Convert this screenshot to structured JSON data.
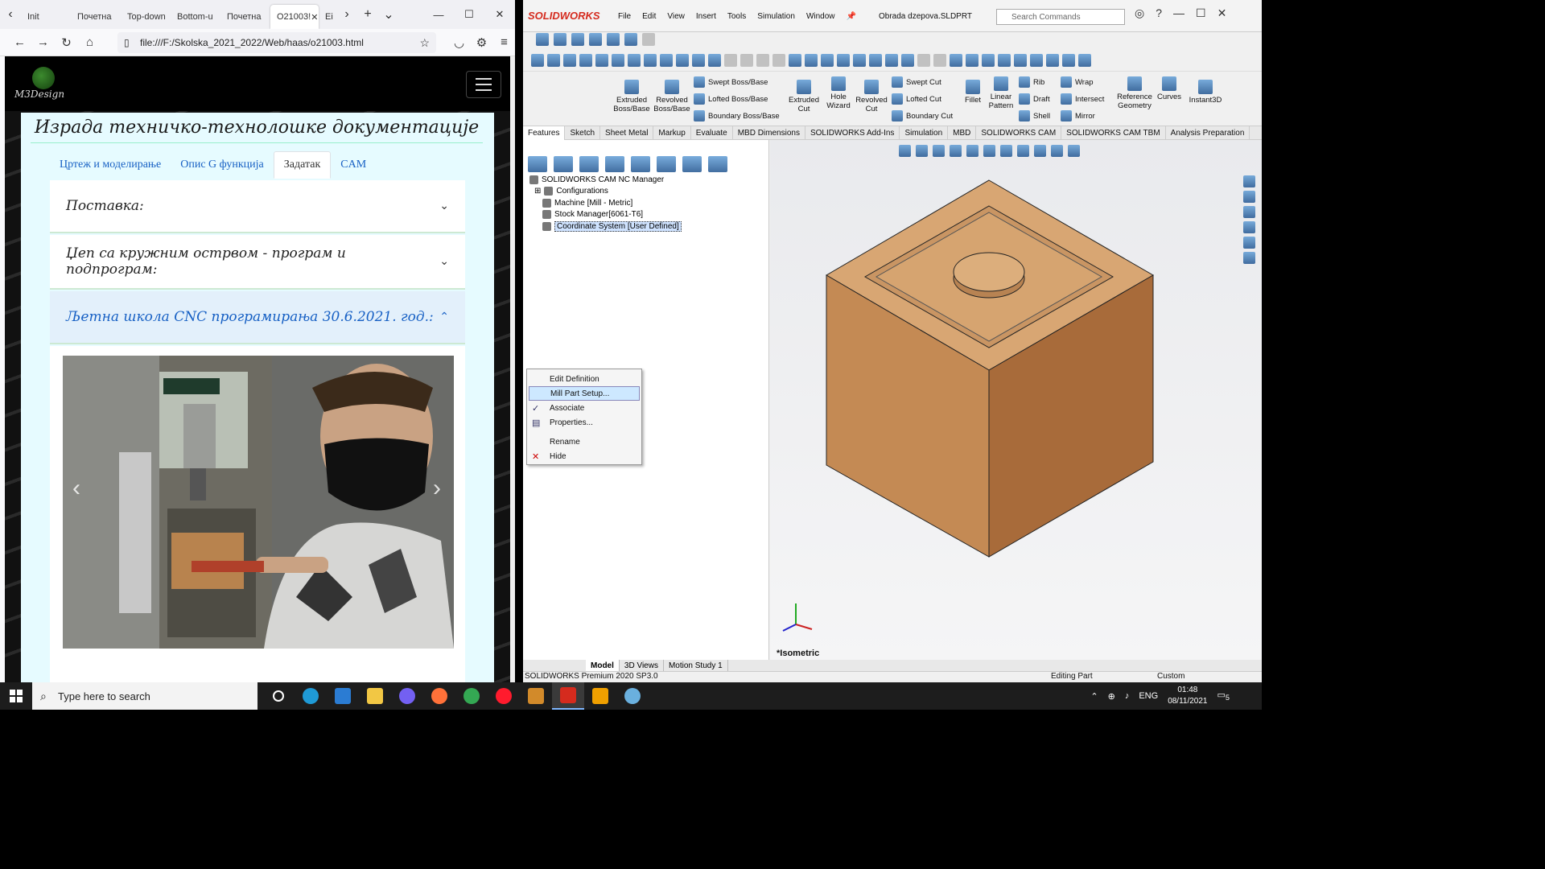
{
  "browser": {
    "tabs": [
      "Init",
      "Почетна",
      "Top-down",
      "Bottom-u",
      "Почетна",
      "O21003!",
      "Ei"
    ],
    "active_tab_index": 5,
    "url": "file:///F:/Skolska_2021_2022/Web/haas/o21003.html",
    "site": {
      "logo_text": "M3Design",
      "title": "Израда техничко-технолошке документације",
      "nav_tabs": [
        "Цртеж и моделирање",
        "Опис G функција",
        "Задатак",
        "CAM"
      ],
      "active_nav_tab": 2,
      "accordion": [
        {
          "label": "Поставка:",
          "open": false
        },
        {
          "label": "Џеп са кружним острвом - програм и подпрограм:",
          "open": false
        },
        {
          "label": "Љетна школа CNC програмирања 30.6.2021. год.:",
          "open": true
        }
      ],
      "carousel": {
        "slide_count": 10,
        "active_slide": 1,
        "prev_icon": "‹",
        "next_icon": "›"
      }
    }
  },
  "solidworks": {
    "logo": "SOLIDWORKS",
    "menu": [
      "File",
      "Edit",
      "View",
      "Insert",
      "Tools",
      "Simulation",
      "Window"
    ],
    "document": "Obrada dzepova.SLDPRT",
    "search_placeholder": "Search Commands",
    "ribbon": {
      "big": [
        "Extruded Boss/Base",
        "Revolved Boss/Base",
        "Extruded Cut",
        "Hole Wizard",
        "Revolved Cut",
        "Fillet",
        "Linear Pattern",
        "Reference Geometry",
        "Curves",
        "Instant3D"
      ],
      "small": [
        "Swept Boss/Base",
        "Lofted Boss/Base",
        "Boundary Boss/Base",
        "Swept Cut",
        "Lofted Cut",
        "Boundary Cut",
        "Rib",
        "Draft",
        "Shell",
        "Wrap",
        "Intersect",
        "Mirror"
      ]
    },
    "command_tabs": [
      "Features",
      "Sketch",
      "Sheet Metal",
      "Markup",
      "Evaluate",
      "MBD Dimensions",
      "SOLIDWORKS Add-Ins",
      "Simulation",
      "MBD",
      "SOLIDWORKS CAM",
      "SOLIDWORKS CAM TBM",
      "Analysis Preparation"
    ],
    "active_command_tab": 0,
    "tree": [
      "SOLIDWORKS CAM NC Manager",
      "Configurations",
      "Machine [Mill - Metric]",
      "Stock Manager[6061-T6]",
      "Coordinate System [User Defined]"
    ],
    "context_menu": [
      {
        "label": "Edit Definition",
        "mark": ""
      },
      {
        "label": "Mill Part Setup...",
        "mark": "",
        "highlighted": true
      },
      {
        "label": "Associate",
        "mark": "✓"
      },
      {
        "label": "Properties...",
        "mark": "▤"
      },
      {
        "label": "Rename",
        "mark": "",
        "gap_before": true
      },
      {
        "label": "Hide",
        "mark": "✕"
      }
    ],
    "view_label": "*Isometric",
    "bottom_tabs": [
      "Model",
      "3D Views",
      "Motion Study 1"
    ],
    "status": {
      "product": "SOLIDWORKS Premium 2020 SP3.0",
      "mode": "Editing Part",
      "units": "Custom"
    }
  },
  "taskbar": {
    "search_placeholder": "Type here to search",
    "language": "ENG",
    "time": "01:48",
    "date": "08/11/2021",
    "notification_count": "5"
  }
}
